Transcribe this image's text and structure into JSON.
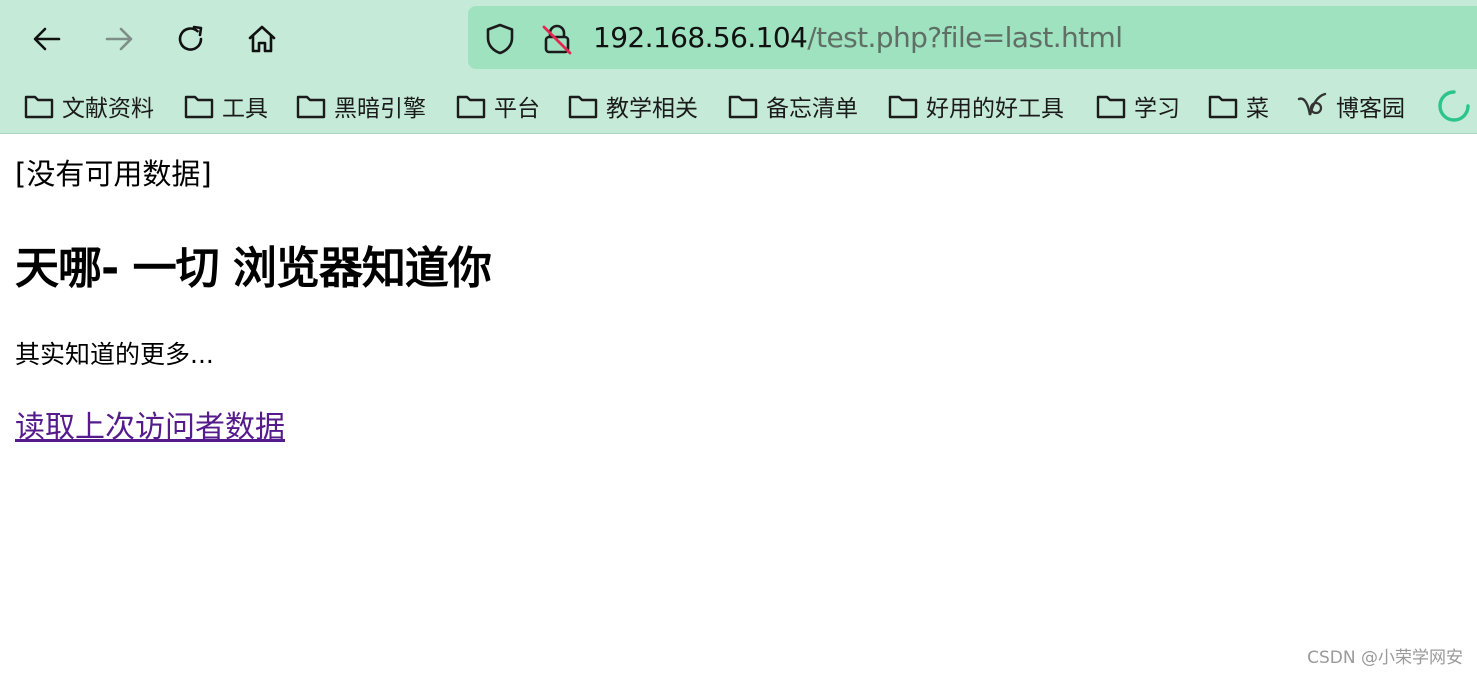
{
  "browser": {
    "url_host": "192.168.56.104",
    "url_path": "/test.php?file=last.html",
    "bookmarks": [
      {
        "label": "文献资料",
        "icon": "folder-icon"
      },
      {
        "label": "工具",
        "icon": "folder-icon"
      },
      {
        "label": "黑暗引擎",
        "icon": "folder-icon"
      },
      {
        "label": "平台",
        "icon": "folder-icon"
      },
      {
        "label": "教学相关",
        "icon": "folder-icon"
      },
      {
        "label": "备忘清单",
        "icon": "folder-icon"
      },
      {
        "label": "好用的好工具",
        "icon": "folder-icon"
      },
      {
        "label": "学习",
        "icon": "folder-icon"
      },
      {
        "label": "菜",
        "icon": "folder-icon"
      },
      {
        "label": "博客园",
        "icon": "cnblogs-icon"
      }
    ]
  },
  "page": {
    "no_data": "[没有可用数据]",
    "headline": "天哪- 一切 浏览器知道你",
    "tagline": "其实知道的更多...",
    "link_text": "读取上次访问者数据"
  },
  "watermark": "CSDN @小荣学网安",
  "colors": {
    "chrome_bg": "#c5ead7",
    "urlbar_bg": "#9fe2bf",
    "visited_link": "#551a8b"
  }
}
